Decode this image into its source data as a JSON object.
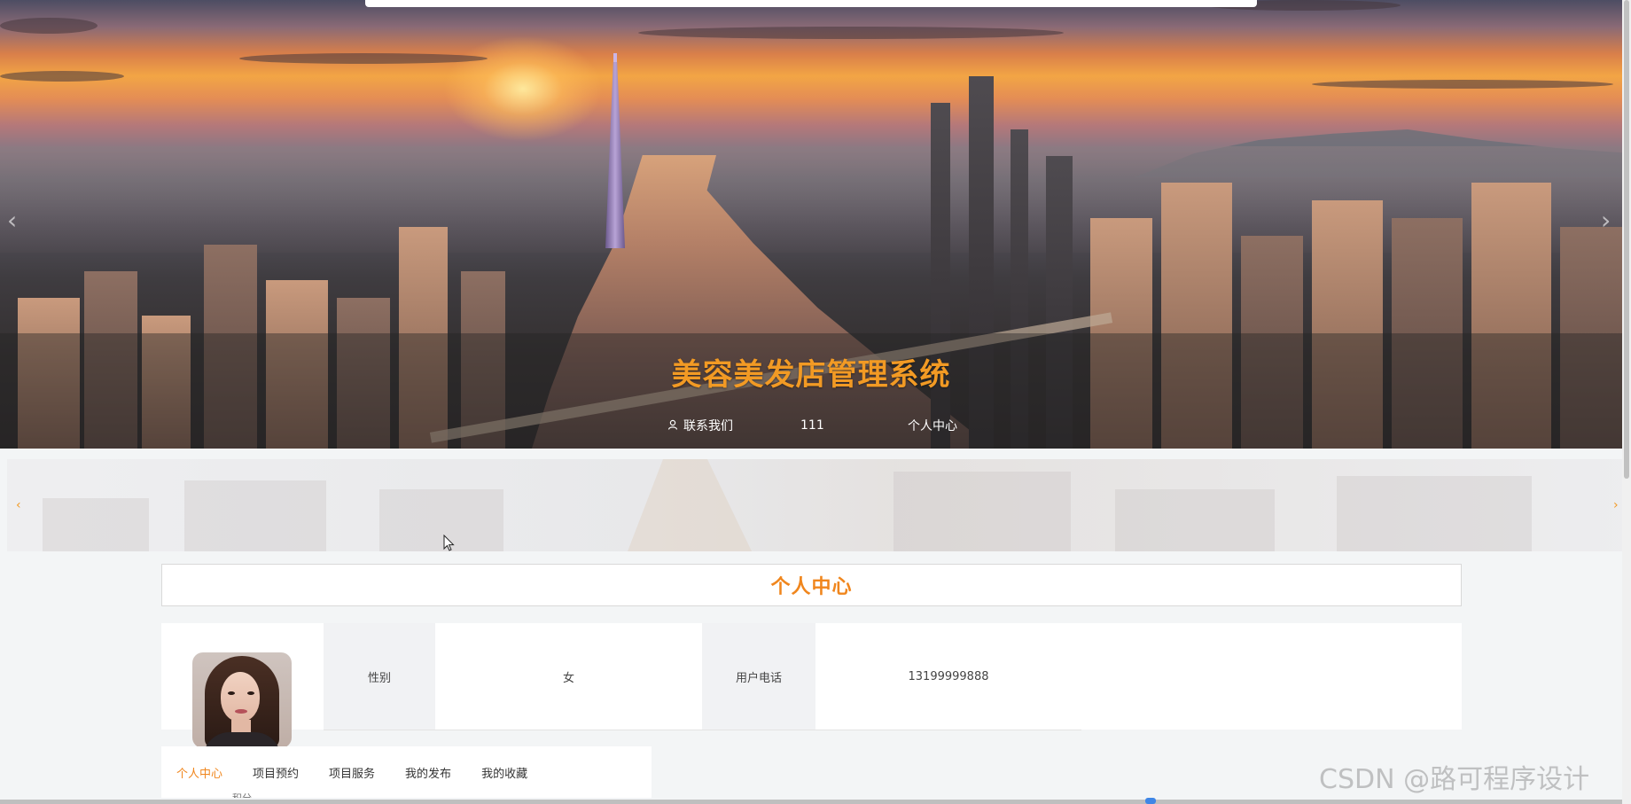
{
  "site": {
    "title": "美容美发店管理系统"
  },
  "nav": {
    "contact_label": "联系我们",
    "user_name": "111",
    "profile_label": "个人中心"
  },
  "section": {
    "title": "个人中心"
  },
  "profile": {
    "gender_label": "性别",
    "gender_value": "女",
    "phone_label": "用户电话",
    "phone_value": "13199999888"
  },
  "tabs": [
    {
      "label": "个人中心",
      "active": true
    },
    {
      "label": "项目预约",
      "active": false
    },
    {
      "label": "项目服务",
      "active": false
    },
    {
      "label": "我的发布",
      "active": false
    },
    {
      "label": "我的收藏",
      "active": false
    }
  ],
  "tab_extra_label": "积分",
  "watermark": "CSDN @路可程序设计",
  "icons": {
    "contact": "user-icon",
    "carousel_prev": "chevron-left-icon",
    "carousel_next": "chevron-right-icon",
    "cursor": "mouse-cursor-icon"
  },
  "colors": {
    "accent": "#f0861d",
    "title": "#f29a24",
    "panel_bg": "#ffffff",
    "label_bg": "#f1f2f4",
    "page_bg": "#f3f5f6"
  }
}
